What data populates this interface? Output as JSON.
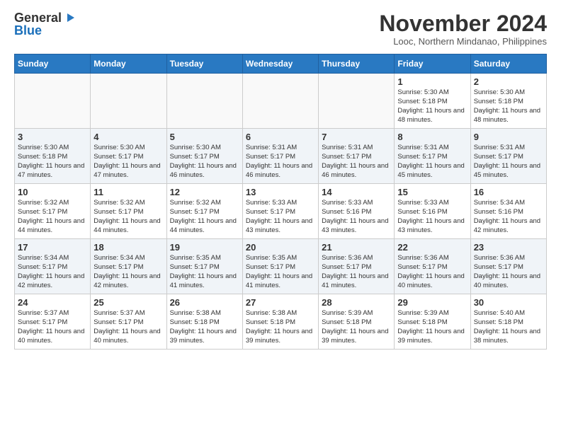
{
  "header": {
    "logo_general": "General",
    "logo_blue": "Blue",
    "month_title": "November 2024",
    "location": "Looc, Northern Mindanao, Philippines"
  },
  "days_of_week": [
    "Sunday",
    "Monday",
    "Tuesday",
    "Wednesday",
    "Thursday",
    "Friday",
    "Saturday"
  ],
  "weeks": [
    [
      {
        "day": "",
        "info": ""
      },
      {
        "day": "",
        "info": ""
      },
      {
        "day": "",
        "info": ""
      },
      {
        "day": "",
        "info": ""
      },
      {
        "day": "",
        "info": ""
      },
      {
        "day": "1",
        "info": "Sunrise: 5:30 AM\nSunset: 5:18 PM\nDaylight: 11 hours and 48 minutes."
      },
      {
        "day": "2",
        "info": "Sunrise: 5:30 AM\nSunset: 5:18 PM\nDaylight: 11 hours and 48 minutes."
      }
    ],
    [
      {
        "day": "3",
        "info": "Sunrise: 5:30 AM\nSunset: 5:18 PM\nDaylight: 11 hours and 47 minutes."
      },
      {
        "day": "4",
        "info": "Sunrise: 5:30 AM\nSunset: 5:17 PM\nDaylight: 11 hours and 47 minutes."
      },
      {
        "day": "5",
        "info": "Sunrise: 5:30 AM\nSunset: 5:17 PM\nDaylight: 11 hours and 46 minutes."
      },
      {
        "day": "6",
        "info": "Sunrise: 5:31 AM\nSunset: 5:17 PM\nDaylight: 11 hours and 46 minutes."
      },
      {
        "day": "7",
        "info": "Sunrise: 5:31 AM\nSunset: 5:17 PM\nDaylight: 11 hours and 46 minutes."
      },
      {
        "day": "8",
        "info": "Sunrise: 5:31 AM\nSunset: 5:17 PM\nDaylight: 11 hours and 45 minutes."
      },
      {
        "day": "9",
        "info": "Sunrise: 5:31 AM\nSunset: 5:17 PM\nDaylight: 11 hours and 45 minutes."
      }
    ],
    [
      {
        "day": "10",
        "info": "Sunrise: 5:32 AM\nSunset: 5:17 PM\nDaylight: 11 hours and 44 minutes."
      },
      {
        "day": "11",
        "info": "Sunrise: 5:32 AM\nSunset: 5:17 PM\nDaylight: 11 hours and 44 minutes."
      },
      {
        "day": "12",
        "info": "Sunrise: 5:32 AM\nSunset: 5:17 PM\nDaylight: 11 hours and 44 minutes."
      },
      {
        "day": "13",
        "info": "Sunrise: 5:33 AM\nSunset: 5:17 PM\nDaylight: 11 hours and 43 minutes."
      },
      {
        "day": "14",
        "info": "Sunrise: 5:33 AM\nSunset: 5:16 PM\nDaylight: 11 hours and 43 minutes."
      },
      {
        "day": "15",
        "info": "Sunrise: 5:33 AM\nSunset: 5:16 PM\nDaylight: 11 hours and 43 minutes."
      },
      {
        "day": "16",
        "info": "Sunrise: 5:34 AM\nSunset: 5:16 PM\nDaylight: 11 hours and 42 minutes."
      }
    ],
    [
      {
        "day": "17",
        "info": "Sunrise: 5:34 AM\nSunset: 5:17 PM\nDaylight: 11 hours and 42 minutes."
      },
      {
        "day": "18",
        "info": "Sunrise: 5:34 AM\nSunset: 5:17 PM\nDaylight: 11 hours and 42 minutes."
      },
      {
        "day": "19",
        "info": "Sunrise: 5:35 AM\nSunset: 5:17 PM\nDaylight: 11 hours and 41 minutes."
      },
      {
        "day": "20",
        "info": "Sunrise: 5:35 AM\nSunset: 5:17 PM\nDaylight: 11 hours and 41 minutes."
      },
      {
        "day": "21",
        "info": "Sunrise: 5:36 AM\nSunset: 5:17 PM\nDaylight: 11 hours and 41 minutes."
      },
      {
        "day": "22",
        "info": "Sunrise: 5:36 AM\nSunset: 5:17 PM\nDaylight: 11 hours and 40 minutes."
      },
      {
        "day": "23",
        "info": "Sunrise: 5:36 AM\nSunset: 5:17 PM\nDaylight: 11 hours and 40 minutes."
      }
    ],
    [
      {
        "day": "24",
        "info": "Sunrise: 5:37 AM\nSunset: 5:17 PM\nDaylight: 11 hours and 40 minutes."
      },
      {
        "day": "25",
        "info": "Sunrise: 5:37 AM\nSunset: 5:17 PM\nDaylight: 11 hours and 40 minutes."
      },
      {
        "day": "26",
        "info": "Sunrise: 5:38 AM\nSunset: 5:18 PM\nDaylight: 11 hours and 39 minutes."
      },
      {
        "day": "27",
        "info": "Sunrise: 5:38 AM\nSunset: 5:18 PM\nDaylight: 11 hours and 39 minutes."
      },
      {
        "day": "28",
        "info": "Sunrise: 5:39 AM\nSunset: 5:18 PM\nDaylight: 11 hours and 39 minutes."
      },
      {
        "day": "29",
        "info": "Sunrise: 5:39 AM\nSunset: 5:18 PM\nDaylight: 11 hours and 39 minutes."
      },
      {
        "day": "30",
        "info": "Sunrise: 5:40 AM\nSunset: 5:18 PM\nDaylight: 11 hours and 38 minutes."
      }
    ]
  ]
}
